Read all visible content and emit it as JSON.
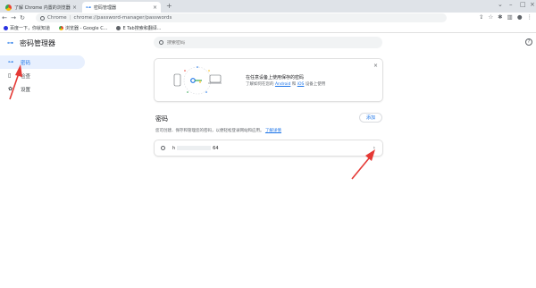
{
  "browser": {
    "tabs": [
      {
        "title": "了解 Chrome 内置的浏览器工具",
        "active": false
      },
      {
        "title": "密码管理器",
        "active": true
      }
    ],
    "new_tab_icon": "plus-icon",
    "window_controls": [
      "minimize-icon",
      "maximize-icon",
      "close-icon"
    ],
    "omnibox": {
      "origin": "Chrome",
      "url": "chrome://password-manager/passwords"
    },
    "bookmarks": [
      "百度一下，你就知道",
      "浏览器 - Google C...",
      "E Tab搜索和翻译..."
    ]
  },
  "app": {
    "title": "密码管理器",
    "search_placeholder": "搜索密码",
    "sidebar": [
      {
        "label": "密码",
        "icon": "key-icon",
        "active": true
      },
      {
        "label": "检查",
        "icon": "shield-icon",
        "active": false
      },
      {
        "label": "设置",
        "icon": "gear-icon",
        "active": false
      }
    ],
    "promo": {
      "line1": "在任意设备上使用保存的密码",
      "line2_prefix": "了解如何在您的",
      "android": "Android",
      "and": "和",
      "ios": "iOS",
      "line2_suffix": "设备上使用"
    },
    "passwords": {
      "title": "密码",
      "add_label": "添加",
      "desc": "您可创建、保存和管理您的密码，以便轻松登录网站和应用。",
      "learn_more": "了解详情",
      "entries": [
        {
          "site_prefix": "h",
          "site_suffix": "64"
        }
      ]
    },
    "colors": {
      "accent": "#1a73e8",
      "annotation": "#e53935"
    }
  }
}
